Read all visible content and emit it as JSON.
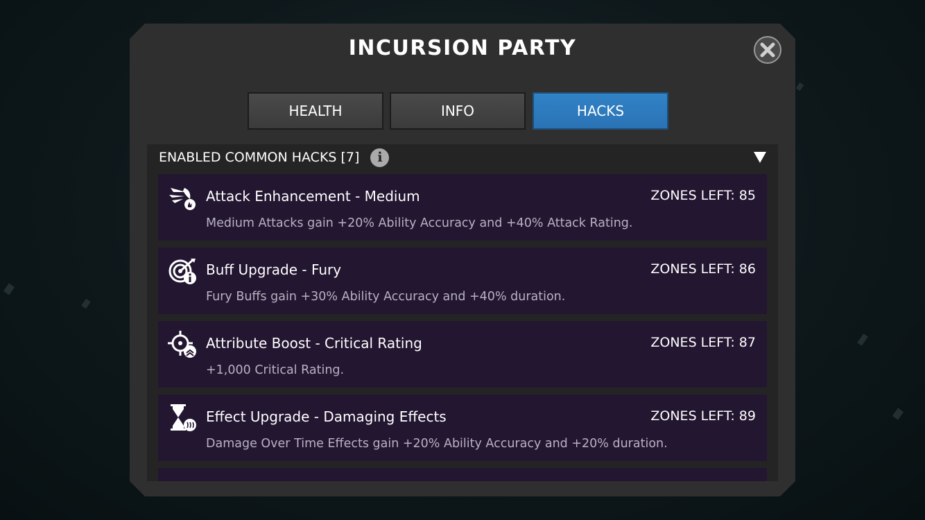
{
  "dialog": {
    "title": "INCURSION PARTY",
    "close_icon": "close-x-icon"
  },
  "tabs": [
    {
      "label": "HEALTH",
      "active": false
    },
    {
      "label": "INFO",
      "active": false
    },
    {
      "label": "HACKS",
      "active": true
    }
  ],
  "section": {
    "title": "ENABLED COMMON HACKS [7]",
    "info_icon": "info-icon",
    "info_glyph": "i",
    "collapse_icon": "triangle-down-icon"
  },
  "hacks": [
    {
      "name": "Attack Enhancement - Medium",
      "zones": "ZONES LEFT: 85",
      "description": "Medium Attacks gain +20% Ability Accuracy and +40% Attack Rating.",
      "icon": "attack-enhancement-icon"
    },
    {
      "name": "Buff Upgrade - Fury",
      "zones": "ZONES LEFT: 86",
      "description": "Fury Buffs gain +30% Ability Accuracy and +40% duration.",
      "icon": "buff-upgrade-icon"
    },
    {
      "name": "Attribute Boost - Critical Rating",
      "zones": "ZONES LEFT: 87",
      "description": "+1,000 Critical Rating.",
      "icon": "attribute-boost-icon"
    },
    {
      "name": "Effect Upgrade - Damaging Effects",
      "zones": "ZONES LEFT: 89",
      "description": "Damage Over Time Effects gain +20% Ability Accuracy and +20% duration.",
      "icon": "effect-upgrade-icon"
    }
  ],
  "colors": {
    "panel": "#2f2f2f",
    "list_bg": "#242424",
    "row_bg": "#231631",
    "active_tab": "#2e7bbf",
    "inactive_tab": "#434343",
    "description_text": "#b8b2c2"
  }
}
